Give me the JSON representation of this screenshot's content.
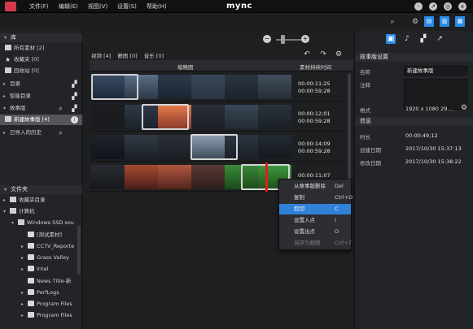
{
  "app": {
    "brand": "mync"
  },
  "menu": [
    "文件(F)",
    "编辑(E)",
    "视图(V)",
    "设置(S)",
    "帮助(H)"
  ],
  "window_controls": [
    "-",
    "↗",
    "◎",
    "x"
  ],
  "left": {
    "library_header": "库",
    "library_items": [
      "所有素材 [2]",
      "收藏夹 [0]",
      "回收站 [0]",
      "目录",
      "智能目录",
      "故事版",
      "新建故事版 [4]",
      "已导入的历史"
    ],
    "folder_header": "文件夹",
    "folder_items": [
      "收藏夹目录",
      "计算机",
      "Windows SSD sou",
      "[测试素材]",
      "CCTV_Reporte",
      "Grass Valley",
      "Intel",
      "News Title-新",
      "PerfLogs",
      "Program Files",
      "Program Files"
    ]
  },
  "center": {
    "filters": [
      "视频 [4]",
      "静图 [0]",
      "音乐 [0]"
    ],
    "columns": {
      "thumbnail": "缩略图",
      "duration": "素材持续时间"
    },
    "clips": [
      {
        "in": "00:00:11;25",
        "out": "00:00:59;28"
      },
      {
        "in": "00:00:12;01",
        "out": "00:00:59;28"
      },
      {
        "in": "00:00:14;09",
        "out": "00:00:59;28"
      },
      {
        "in": "00:00:11;07",
        "out": ""
      }
    ]
  },
  "context_menu": [
    {
      "label": "从故事版删除",
      "key": "Del",
      "state": "normal"
    },
    {
      "label": "复制",
      "key": "Ctrl+D",
      "state": "normal"
    },
    {
      "label": "剪切",
      "key": "C",
      "state": "selected"
    },
    {
      "label": "设置入点",
      "key": "I",
      "state": "normal"
    },
    {
      "label": "设置出点",
      "key": "O",
      "state": "normal"
    },
    {
      "label": "另存为静图",
      "key": "Ctrl+T",
      "state": "disabled"
    }
  ],
  "right": {
    "settings_header": "故事版设置",
    "name_label": "名称",
    "name_value": "新建故事版",
    "note_label": "注释",
    "format_label": "格式",
    "format_value": "1920 x 1080 29....",
    "info_header": "信息",
    "duration_label": "时长",
    "duration_value": "00:00:49;12",
    "created_label": "创建日期",
    "created_value": "2017/10/30 15:37:13",
    "modified_label": "修改日期",
    "modified_value": "2017/10/30 15:38:22"
  },
  "colors": {
    "accent": "#2f82d8",
    "logo": "#d33b4a",
    "playhead": "#e21b1b"
  }
}
